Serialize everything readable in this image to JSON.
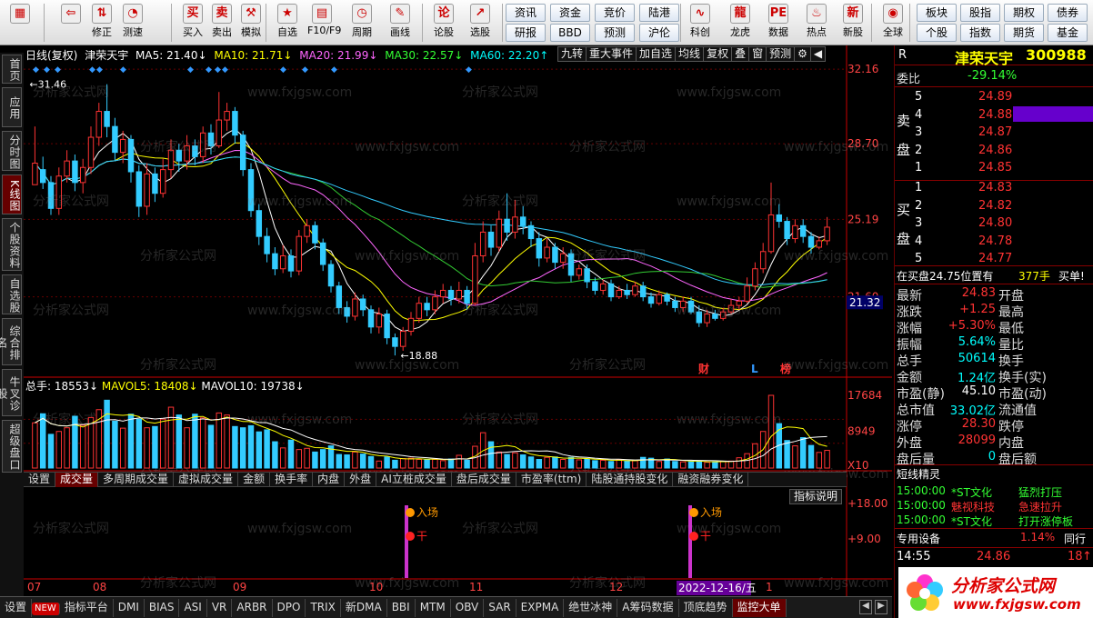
{
  "toolbar": {
    "buttons": [
      {
        "label": "",
        "icon": "grid-icon"
      },
      {
        "label": "",
        "icon": "back-arrow-icon"
      },
      {
        "label": "修正",
        "icon": "updown-icon"
      },
      {
        "label": "测速",
        "icon": "speed-icon"
      },
      {
        "label": "买入",
        "icon": "buy-icon"
      },
      {
        "label": "卖出",
        "icon": "sell-icon"
      },
      {
        "label": "模拟",
        "icon": "hammer-icon"
      },
      {
        "label": "自选",
        "icon": "star-icon"
      },
      {
        "label": "F10/F9",
        "icon": "f10-icon"
      },
      {
        "label": "周期",
        "icon": "clock-icon"
      },
      {
        "label": "画线",
        "icon": "pencil-icon"
      },
      {
        "label": "论股",
        "icon": "discuss-icon"
      },
      {
        "label": "选股",
        "icon": "chart-icon"
      },
      {
        "label": "科创",
        "icon": "kc-icon"
      },
      {
        "label": "龙虎",
        "icon": "dragon-icon"
      },
      {
        "label": "数据",
        "icon": "pe-icon"
      },
      {
        "label": "热点",
        "icon": "fire-icon"
      },
      {
        "label": "新股",
        "icon": "newstock-icon"
      },
      {
        "label": "全球",
        "icon": "globe-icon"
      }
    ],
    "mid_buttons": [
      [
        "资讯",
        "资金",
        "竞价",
        "陆港"
      ],
      [
        "研报",
        "BBD",
        "预测",
        "沪伦"
      ]
    ],
    "right_buttons": [
      [
        "板块",
        "股指",
        "期权",
        "债券"
      ],
      [
        "个股",
        "指数",
        "期货",
        "基金"
      ]
    ]
  },
  "sidebar": [
    "首页",
    "应用",
    "分时图",
    "K线图",
    "个股资料",
    "自选股",
    "综合排名",
    "牛叉诊股",
    "超级盘口"
  ],
  "chart_header": {
    "period": "日线(复权)",
    "name": "津荣天宇",
    "ma5": "MA5: 21.40↓",
    "ma10": "MA10: 21.71↓",
    "ma20": "MA20: 21.99↓",
    "ma30": "MA30: 22.57↓",
    "ma60": "MA60: 22.20↑",
    "right_buttons": [
      "九转",
      "重大事件",
      "加自选",
      "均线",
      "复权",
      "叠",
      "窗",
      "预测"
    ]
  },
  "price_axis": [
    "32.16",
    "28.70",
    "25.19",
    "21.60"
  ],
  "current_price_tag": "21.32",
  "hi_label": "←31.46",
  "lo_label": "←18.88",
  "event_marks": [
    "财",
    "L",
    "榜"
  ],
  "volume": {
    "header": {
      "total": "总手: 18553↓",
      "mavol5": "MAVOL5: 18408↓",
      "mavol10": "MAVOL10: 19738↓"
    },
    "axis": [
      "17684",
      "8949",
      "X10"
    ]
  },
  "ind_tabs": [
    "设置",
    "成交量",
    "多周期成交量",
    "虚拟成交量",
    "金额",
    "换手率",
    "内盘",
    "外盘",
    "AI立桩成交量",
    "盘后成交量",
    "市盈率(ttm)",
    "陆股通持股变化",
    "融资融券变化"
  ],
  "ind_help": "指标说明",
  "signal_axis": [
    "+18.00",
    "+9.00"
  ],
  "signals": [
    {
      "enter": "入场",
      "dry": "干"
    },
    {
      "enter": "入场",
      "dry": "干"
    }
  ],
  "months": [
    "07",
    "08",
    "09",
    "10",
    "11",
    "12",
    "1"
  ],
  "date_tag": "2022-12-16/五",
  "bottom_tabs": [
    "设置",
    "NEW",
    "指标平台",
    "DMI",
    "BIAS",
    "ASI",
    "VR",
    "ARBR",
    "DPO",
    "TRIX",
    "新DMA",
    "BBI",
    "MTM",
    "OBV",
    "SAR",
    "EXPMA",
    "绝世冰神",
    "A筹码数据",
    "顶底趋势",
    "监控大单"
  ],
  "quote": {
    "flag": "R",
    "name": "津荣天宇",
    "code": "300988",
    "weibi_label": "委比",
    "weibi": "-29.14%",
    "sell_label": "卖盘",
    "buy_label": "买盘",
    "sells": [
      [
        "5",
        "24.89"
      ],
      [
        "4",
        "24.88"
      ],
      [
        "3",
        "24.87"
      ],
      [
        "2",
        "24.86"
      ],
      [
        "1",
        "24.85"
      ]
    ],
    "buys": [
      [
        "1",
        "24.83"
      ],
      [
        "2",
        "24.82"
      ],
      [
        "3",
        "24.80"
      ],
      [
        "4",
        "24.78"
      ],
      [
        "5",
        "24.77"
      ]
    ],
    "status": {
      "text": "在买盘24.75位置有",
      "qty": "377手",
      "tag": "买单!"
    },
    "rows": [
      [
        "最新",
        "24.83",
        "开盘",
        ""
      ],
      [
        "涨跌",
        "+1.25",
        "最高",
        ""
      ],
      [
        "涨幅",
        "+5.30%",
        "最低",
        ""
      ],
      [
        "振幅",
        "5.64%",
        "量比",
        ""
      ],
      [
        "总手",
        "50614",
        "换手",
        ""
      ],
      [
        "金额",
        "1.24亿",
        "换手(实)",
        ""
      ],
      [
        "市盈(静)",
        "45.10",
        "市盈(动)",
        ""
      ],
      [
        "总市值",
        "33.02亿",
        "流通值",
        ""
      ],
      [
        "涨停",
        "28.30",
        "跌停",
        ""
      ],
      [
        "外盘",
        "28099",
        "内盘",
        ""
      ],
      [
        "盘后量",
        "0",
        "盘后额",
        ""
      ]
    ],
    "short_title": "短线精灵",
    "short": [
      [
        "15:00:00",
        "*ST文化",
        "猛烈打压"
      ],
      [
        "15:00:00",
        "魅视科技",
        "急速拉升"
      ],
      [
        "15:00:00",
        "*ST文化",
        "打开涨停板"
      ]
    ],
    "special_label": "专用设备",
    "special_pct": "1.14%",
    "special_more": "同行",
    "tick": {
      "time": "14:55",
      "price": "24.86",
      "qty": "18",
      "arrow": "↑"
    },
    "watermark_cn": "分析家公式网",
    "watermark_url": "www.fxjgsw.com"
  },
  "chart_data": {
    "type": "candlestick",
    "ylim": [
      18.0,
      32.5
    ],
    "candles": [
      [
        26.8,
        27.8,
        27.5,
        29.5
      ],
      [
        27.5,
        26.9,
        26.6,
        28.1
      ],
      [
        26.9,
        25.7,
        25.4,
        27.2
      ],
      [
        25.7,
        27.2,
        25.4,
        27.6
      ],
      [
        27.2,
        27.9,
        26.9,
        28.4
      ],
      [
        27.9,
        26.9,
        26.5,
        28.2
      ],
      [
        26.9,
        27.6,
        26.4,
        28.0
      ],
      [
        27.6,
        29.0,
        27.3,
        29.5
      ],
      [
        29.0,
        30.2,
        28.6,
        30.6
      ],
      [
        30.2,
        29.5,
        29.0,
        31.46
      ],
      [
        29.5,
        28.3,
        27.9,
        29.9
      ],
      [
        28.3,
        28.9,
        27.8,
        29.3
      ],
      [
        28.9,
        27.4,
        26.9,
        29.1
      ],
      [
        27.4,
        25.8,
        25.3,
        27.7
      ],
      [
        25.8,
        27.3,
        25.4,
        27.8
      ],
      [
        27.3,
        26.4,
        26.0,
        27.6
      ],
      [
        26.4,
        27.5,
        26.2,
        28.0
      ],
      [
        27.5,
        28.4,
        27.1,
        28.9
      ],
      [
        28.4,
        27.9,
        27.4,
        28.7
      ],
      [
        27.9,
        28.6,
        27.5,
        29.1
      ],
      [
        28.6,
        28.1,
        27.7,
        28.9
      ],
      [
        28.1,
        29.2,
        27.8,
        29.5
      ],
      [
        29.2,
        28.6,
        28.2,
        29.6
      ],
      [
        28.6,
        29.8,
        28.5,
        31.1
      ],
      [
        29.8,
        30.2,
        29.3,
        30.6
      ],
      [
        30.2,
        29.1,
        28.7,
        30.4
      ],
      [
        29.1,
        27.5,
        27.2,
        29.3
      ],
      [
        27.5,
        25.6,
        25.3,
        27.8
      ],
      [
        25.6,
        24.4,
        24.0,
        25.9
      ],
      [
        24.4,
        23.6,
        23.2,
        24.8
      ],
      [
        23.6,
        22.9,
        22.6,
        23.9
      ],
      [
        22.9,
        23.5,
        22.7,
        24.0
      ],
      [
        23.5,
        22.8,
        22.5,
        23.8
      ],
      [
        22.8,
        24.4,
        22.6,
        24.7
      ],
      [
        24.4,
        24.9,
        24.1,
        25.2
      ],
      [
        24.9,
        24.1,
        23.8,
        25.1
      ],
      [
        24.1,
        23.1,
        22.8,
        24.3
      ],
      [
        23.1,
        22.1,
        21.8,
        23.3
      ],
      [
        22.1,
        21.1,
        20.8,
        22.3
      ],
      [
        21.1,
        20.7,
        20.4,
        21.4
      ],
      [
        20.7,
        21.5,
        20.5,
        21.8
      ],
      [
        21.5,
        21.0,
        20.7,
        21.7
      ],
      [
        21.0,
        20.2,
        19.9,
        21.2
      ],
      [
        20.2,
        20.8,
        19.9,
        21.1
      ],
      [
        20.8,
        19.7,
        19.4,
        21.0
      ],
      [
        19.7,
        19.3,
        18.88,
        19.9
      ],
      [
        19.3,
        20.0,
        19.1,
        20.2
      ],
      [
        20.0,
        20.6,
        19.8,
        20.9
      ],
      [
        20.6,
        21.3,
        20.4,
        21.6
      ],
      [
        21.3,
        21.0,
        20.7,
        21.6
      ],
      [
        21.0,
        21.6,
        20.8,
        21.9
      ],
      [
        21.6,
        21.9,
        21.3,
        22.2
      ],
      [
        21.9,
        21.5,
        21.2,
        22.1
      ],
      [
        21.5,
        21.9,
        21.3,
        22.3
      ],
      [
        21.9,
        21.3,
        21.0,
        22.1
      ],
      [
        21.3,
        23.5,
        21.2,
        24.1
      ],
      [
        23.5,
        24.6,
        23.2,
        25.1
      ],
      [
        24.6,
        23.9,
        23.5,
        24.9
      ],
      [
        23.9,
        25.2,
        23.7,
        25.6
      ],
      [
        25.2,
        24.6,
        24.2,
        26.4
      ],
      [
        24.6,
        25.3,
        24.3,
        26.1
      ],
      [
        25.3,
        24.9,
        24.5,
        25.8
      ],
      [
        24.9,
        24.3,
        23.9,
        25.1
      ],
      [
        24.3,
        23.4,
        23.0,
        24.6
      ],
      [
        23.4,
        23.9,
        23.2,
        24.3
      ],
      [
        23.9,
        23.2,
        22.9,
        24.1
      ],
      [
        23.2,
        23.6,
        22.9,
        23.9
      ],
      [
        23.6,
        22.6,
        22.3,
        23.8
      ],
      [
        22.6,
        22.9,
        22.4,
        23.1
      ],
      [
        22.9,
        22.3,
        22.0,
        23.1
      ],
      [
        22.3,
        21.9,
        21.7,
        22.5
      ],
      [
        21.9,
        22.2,
        21.7,
        22.4
      ],
      [
        22.2,
        21.6,
        21.4,
        22.4
      ],
      [
        21.6,
        21.9,
        21.5,
        22.1
      ],
      [
        21.9,
        21.7,
        21.5,
        22.2
      ],
      [
        21.7,
        22.1,
        21.6,
        22.3
      ],
      [
        22.1,
        21.6,
        21.4,
        22.3
      ],
      [
        21.6,
        21.3,
        21.1,
        21.8
      ],
      [
        21.3,
        21.7,
        21.2,
        21.9
      ],
      [
        21.7,
        21.4,
        21.2,
        21.8
      ],
      [
        21.4,
        21.1,
        20.9,
        21.6
      ],
      [
        21.1,
        21.4,
        20.9,
        21.6
      ],
      [
        21.4,
        20.9,
        20.8,
        21.6
      ],
      [
        20.9,
        20.4,
        20.2,
        21.2
      ],
      [
        20.4,
        20.8,
        20.2,
        21.0
      ],
      [
        20.8,
        20.6,
        20.5,
        21.0
      ],
      [
        20.6,
        20.9,
        20.5,
        21.1
      ],
      [
        20.9,
        21.2,
        20.8,
        21.5
      ],
      [
        21.2,
        21.4,
        21.0,
        21.6
      ],
      [
        21.4,
        22.1,
        21.3,
        22.5
      ],
      [
        22.1,
        22.9,
        21.9,
        23.2
      ],
      [
        22.9,
        23.7,
        22.7,
        24.1
      ],
      [
        23.7,
        25.4,
        23.6,
        26.9
      ],
      [
        25.4,
        25.1,
        24.8,
        25.9
      ],
      [
        25.1,
        24.3,
        24.0,
        25.3
      ],
      [
        24.3,
        24.9,
        24.1,
        25.2
      ],
      [
        24.9,
        24.4,
        24.1,
        25.2
      ],
      [
        24.4,
        23.9,
        23.6,
        24.6
      ],
      [
        23.9,
        24.2,
        23.8,
        24.4
      ],
      [
        24.2,
        24.83,
        24.0,
        25.3
      ]
    ],
    "volumes": [
      11000,
      13200,
      8200,
      8900,
      9800,
      12600,
      10400,
      12300,
      14200,
      16500,
      11400,
      9700,
      13100,
      11900,
      9800,
      10100,
      11900,
      14800,
      12900,
      9800,
      13100,
      12200,
      10400,
      13400,
      12900,
      10100,
      9800,
      10300,
      8800,
      9300,
      6400,
      4900,
      6800,
      4500,
      4800,
      3900,
      4500,
      5400,
      3300,
      3200,
      3900,
      3400,
      2800,
      1700,
      2700,
      1900,
      2300,
      2400,
      2100,
      2000,
      2100,
      1800,
      2200,
      3100,
      1900,
      5300,
      8600,
      6400,
      3900,
      3300,
      3700,
      3200,
      2700,
      2100,
      2600,
      2700,
      2100,
      2600,
      2000,
      2200,
      1800,
      1900,
      1600,
      2000,
      1700,
      1800,
      2600,
      2400,
      1600,
      2200,
      1600,
      1500,
      1500,
      1700,
      1400,
      1500,
      1600,
      1700,
      2500,
      3500,
      5900,
      8900,
      17684,
      10800,
      6700,
      5400,
      7400,
      5500,
      3800,
      4300
    ]
  }
}
